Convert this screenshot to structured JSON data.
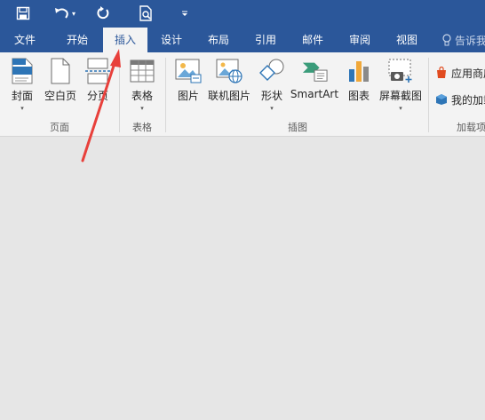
{
  "colors": {
    "brand": "#2b579a",
    "arrow": "#e8403b",
    "ribbon_bg": "#f3f3f3",
    "doc_bg": "#e6e6e6"
  },
  "qat": {
    "items": [
      {
        "name": "save-icon"
      },
      {
        "name": "undo-icon"
      },
      {
        "name": "redo-icon"
      },
      {
        "name": "print-preview-icon"
      },
      {
        "name": "customize-qat-icon"
      }
    ]
  },
  "tabs": {
    "items": [
      {
        "label": "文件"
      },
      {
        "label": "开始"
      },
      {
        "label": "插入",
        "active": true
      },
      {
        "label": "设计"
      },
      {
        "label": "布局"
      },
      {
        "label": "引用"
      },
      {
        "label": "邮件"
      },
      {
        "label": "审阅"
      },
      {
        "label": "视图"
      }
    ],
    "tell_me": "告诉我"
  },
  "ribbon": {
    "pages_group": {
      "label": "页面",
      "buttons": [
        {
          "label": "封面",
          "has_dropdown": true
        },
        {
          "label": "空白页"
        },
        {
          "label": "分页"
        }
      ]
    },
    "tables_group": {
      "label": "表格",
      "buttons": [
        {
          "label": "表格",
          "has_dropdown": true
        }
      ]
    },
    "illustrations_group": {
      "label": "插图",
      "buttons": [
        {
          "label": "图片"
        },
        {
          "label": "联机图片"
        },
        {
          "label": "形状",
          "has_dropdown": true
        },
        {
          "label": "SmartArt"
        },
        {
          "label": "图表"
        },
        {
          "label": "屏幕截图",
          "has_dropdown": true
        }
      ]
    },
    "addins_group": {
      "label": "加载项",
      "buttons": [
        {
          "label": "应用商店"
        },
        {
          "label": "我的加载项"
        }
      ]
    }
  },
  "dropdown_glyph": "▾"
}
